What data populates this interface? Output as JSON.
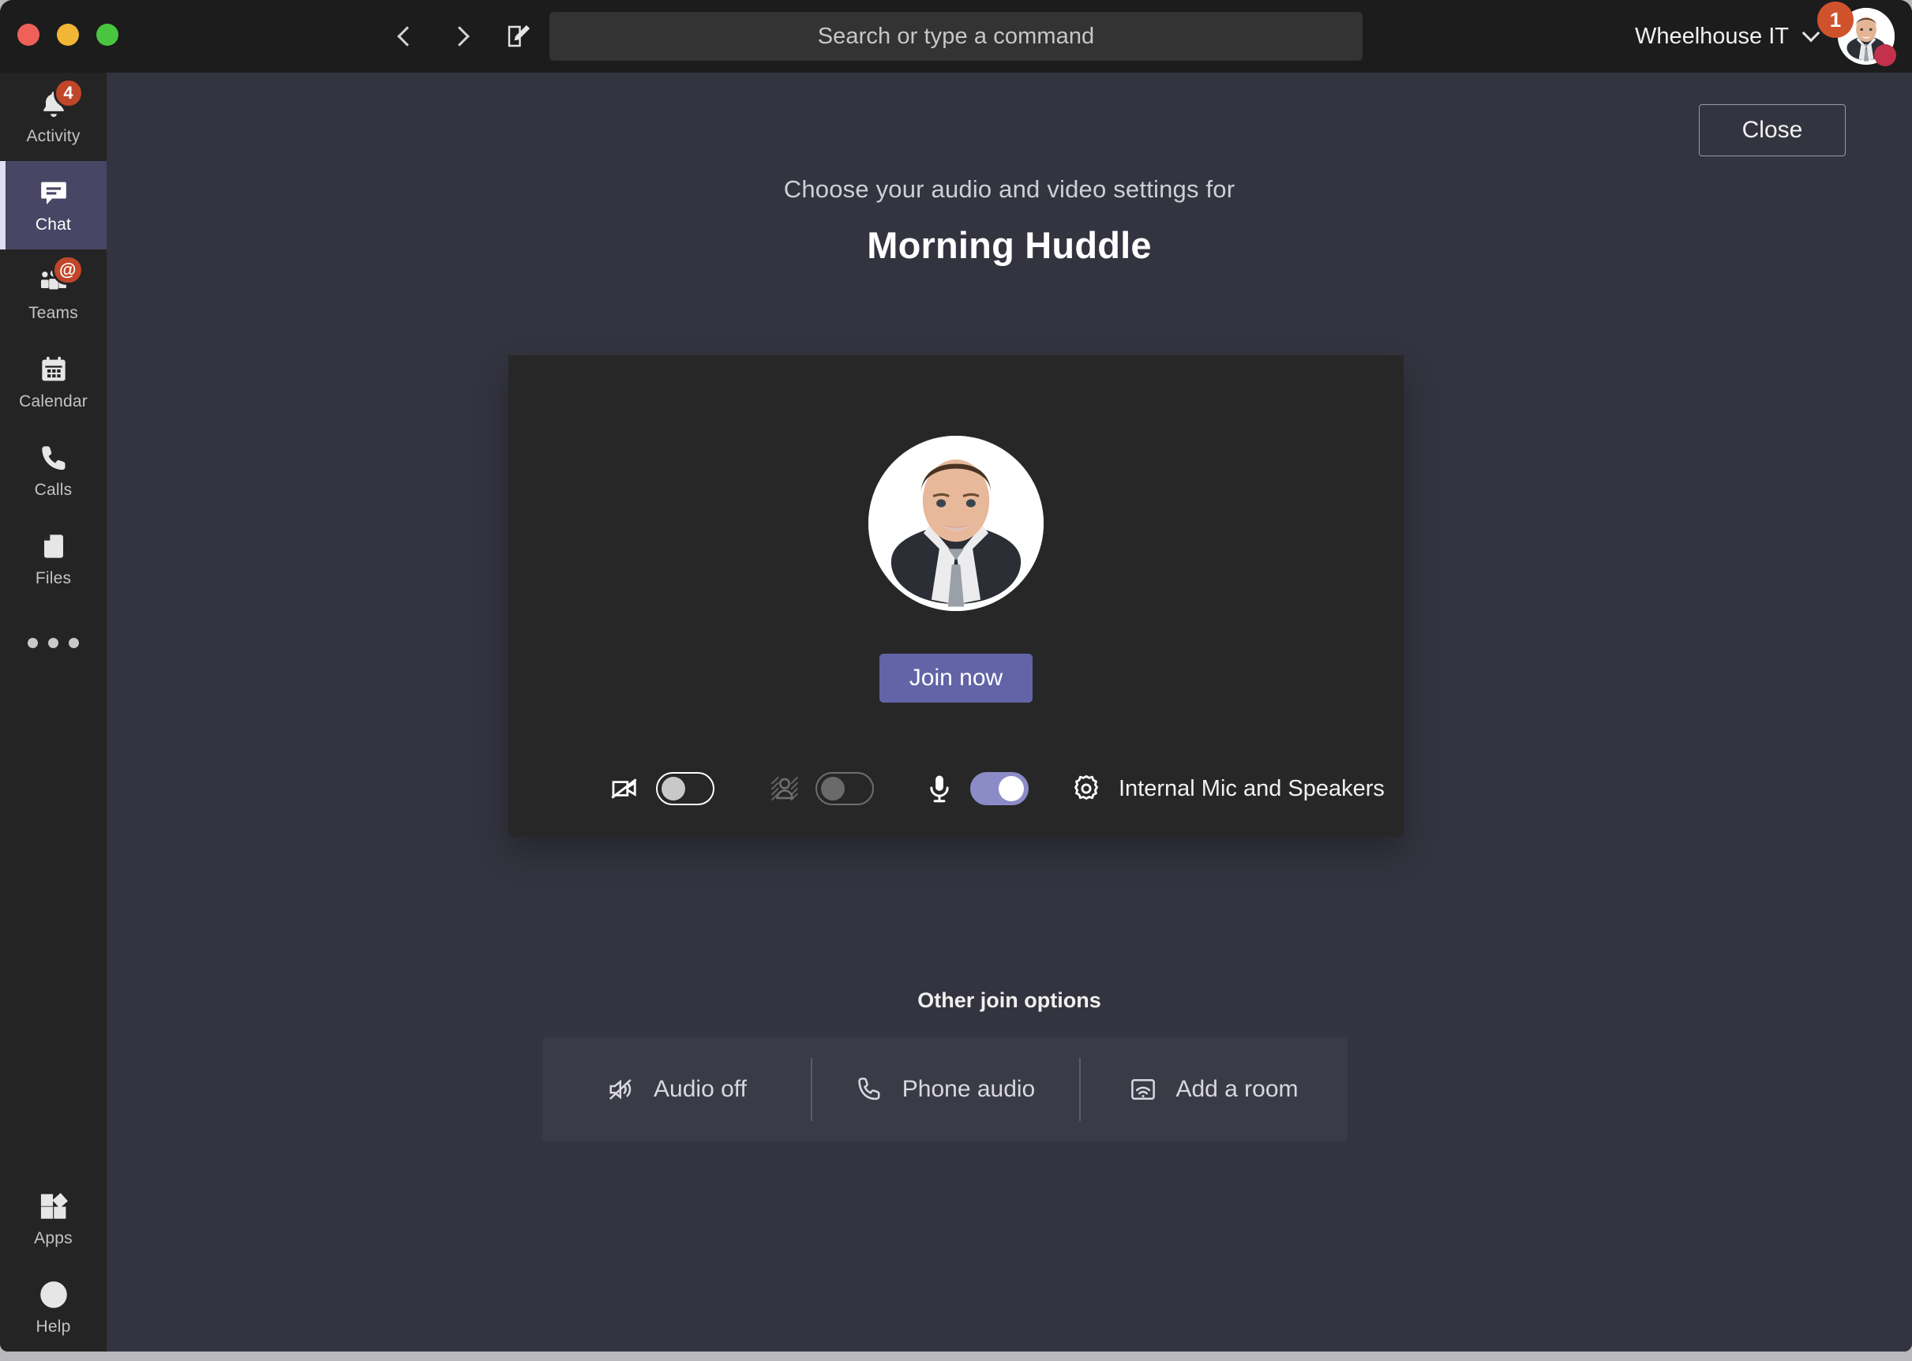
{
  "window": {
    "traffic_lights": [
      "close",
      "minimize",
      "maximize"
    ]
  },
  "titlebar": {
    "back_icon": "chevron-left-icon",
    "forward_icon": "chevron-right-icon",
    "compose_icon": "compose-icon",
    "search": {
      "placeholder": "Search or type a command",
      "value": ""
    },
    "org_name": "Wheelhouse IT",
    "org_chevron_icon": "chevron-down-icon",
    "avatar_badge_count": "1",
    "presence": "busy",
    "presence_color": "#c4314b",
    "badge_color": "#d0522c"
  },
  "rail": {
    "items": [
      {
        "label": "Activity",
        "icon": "bell-icon",
        "badge": "4",
        "active": false
      },
      {
        "label": "Chat",
        "icon": "chat-icon",
        "badge": "",
        "active": true
      },
      {
        "label": "Teams",
        "icon": "teams-icon",
        "badge": "@",
        "active": false
      },
      {
        "label": "Calendar",
        "icon": "calendar-icon",
        "badge": "",
        "active": false
      },
      {
        "label": "Calls",
        "icon": "phone-icon",
        "badge": "",
        "active": false
      },
      {
        "label": "Files",
        "icon": "file-icon",
        "badge": "",
        "active": false
      }
    ],
    "more_icon": "ellipsis-icon",
    "bottom_items": [
      {
        "label": "Apps",
        "icon": "apps-icon"
      },
      {
        "label": "Help",
        "icon": "help-icon"
      }
    ],
    "active_color": "#484664",
    "accent_color": "#dedef4"
  },
  "stage": {
    "close_label": "Close",
    "subtitle": "Choose your audio and video settings for",
    "meeting_title": "Morning Huddle",
    "preview": {
      "avatar_alt": "user-avatar",
      "join_label": "Join now",
      "join_color": "#6264a7",
      "controls": [
        {
          "name": "camera",
          "icon": "camera-off-icon",
          "state": "off",
          "disabled": false
        },
        {
          "name": "background-blur",
          "icon": "background-blur-icon",
          "state": "off",
          "disabled": true
        },
        {
          "name": "microphone",
          "icon": "microphone-icon",
          "state": "on",
          "disabled": false
        }
      ],
      "device_settings_icon": "gear-icon",
      "device_label": "Internal Mic and Speakers"
    },
    "other_join": {
      "title": "Other join options",
      "options": [
        {
          "label": "Audio off",
          "icon": "speaker-muted-icon"
        },
        {
          "label": "Phone audio",
          "icon": "phone-icon"
        },
        {
          "label": "Add a room",
          "icon": "cast-room-icon"
        }
      ]
    }
  }
}
